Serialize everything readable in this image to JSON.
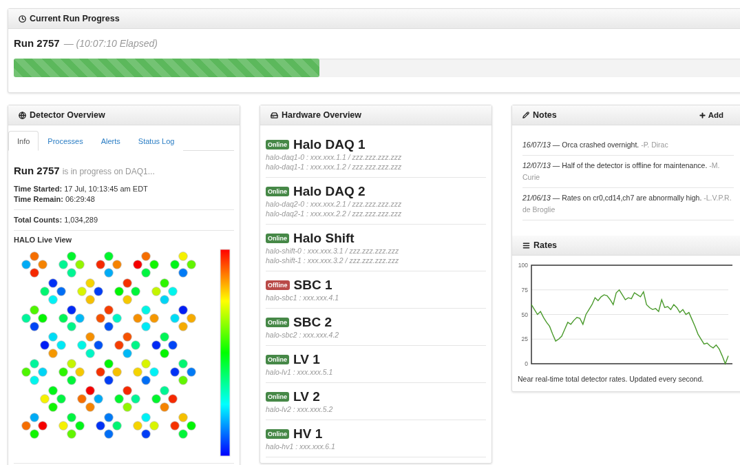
{
  "progress": {
    "title": "Current Run Progress",
    "run": "Run 2757",
    "elapsed": "— (10:07:10 Elapsed)",
    "level": 0.42
  },
  "detector": {
    "title": "Detector Overview",
    "tabs": [
      {
        "label": "Info",
        "selected": true
      },
      {
        "label": "Processes",
        "selected": false
      },
      {
        "label": "Alerts",
        "selected": false
      },
      {
        "label": "Status Log",
        "selected": false
      }
    ],
    "run": "Run 2757",
    "run_status": "is in progress on DAQ1...",
    "fields": [
      {
        "label": "Time Started:",
        "value": "17 Jul, 10:13:45 am EDT"
      },
      {
        "label": "Time Remain:",
        "value": "06:29:48"
      }
    ],
    "total": {
      "label": "Total Counts:",
      "value": "1,034,289"
    },
    "live_view_title": "HALO Live View"
  },
  "hardware": {
    "title": "Hardware Overview",
    "items": [
      {
        "status": "Online",
        "online": true,
        "name": "Halo DAQ 1",
        "hosts": [
          "halo-daq1-0 : xxx.xxx.1.1 / zzz.zzz.zzz.zzz",
          "halo-daq1-1 : xxx.xxx.1.2 / zzz.zzz.zzz.zzz"
        ]
      },
      {
        "status": "Online",
        "online": true,
        "name": "Halo DAQ 2",
        "hosts": [
          "halo-daq2-0 : xxx.xxx.2.1 / zzz.zzz.zzz.zzz",
          "halo-daq2-1 : xxx.xxx.2.2 / zzz.zzz.zzz.zzz"
        ]
      },
      {
        "status": "Online",
        "online": true,
        "name": "Halo Shift",
        "hosts": [
          "halo-shift-0 : xxx.xxx.3.1 / zzz.zzz.zzz.zzz",
          "halo-shift-1 : xxx.xxx.3.2 / zzz.zzz.zzz.zzz"
        ]
      },
      {
        "status": "Offline",
        "online": false,
        "name": "SBC 1",
        "hosts": [
          "halo-sbc1 : xxx.xxx.4.1"
        ]
      },
      {
        "status": "Online",
        "online": true,
        "name": "SBC 2",
        "hosts": [
          "halo-sbc2 : xxx.xxx.4.2"
        ]
      },
      {
        "status": "Online",
        "online": true,
        "name": "LV 1",
        "hosts": [
          "halo-lv1 : xxx.xxx.5.1"
        ]
      },
      {
        "status": "Online",
        "online": true,
        "name": "LV 2",
        "hosts": [
          "halo-lv2 : xxx.xxx.5.2"
        ]
      },
      {
        "status": "Online",
        "online": true,
        "name": "HV 1",
        "hosts": [
          "halo-hv1 : xxx.xxx.6.1"
        ]
      }
    ]
  },
  "notes": {
    "title": "Notes",
    "add": "Add",
    "items": [
      {
        "date": "16/07/13",
        "text": "— Orca crashed overnight.",
        "author": "-P. Dirac"
      },
      {
        "date": "12/07/13",
        "text": "— Half of the detector is offline for maintenance.",
        "author": "-M. Curie"
      },
      {
        "date": "21/06/13",
        "text": "— Rates on cr0,cd14,ch7 are abnormally high.",
        "author": "-L.V.P.R. de Broglie"
      }
    ]
  },
  "rates": {
    "title": "Rates",
    "caption": "Near real-time total detector rates. Updated every second.",
    "chart_data": {
      "type": "line",
      "grid": true,
      "ylim": [
        0,
        100
      ],
      "yticks": [
        0,
        25,
        50,
        75,
        100
      ],
      "series": [
        {
          "color": "#4a9a2c",
          "values": [
            60,
            55,
            50,
            53,
            47,
            42,
            38,
            30,
            23,
            25,
            28,
            35,
            42,
            40,
            44,
            47,
            46,
            40,
            50,
            55,
            60,
            67,
            64,
            68,
            70,
            69,
            65,
            60,
            72,
            75,
            70,
            65,
            67,
            66,
            72,
            70,
            68,
            73,
            60,
            57,
            55,
            56,
            53,
            65,
            57,
            58,
            55,
            60,
            57,
            52,
            55,
            50,
            52,
            45,
            38,
            30,
            25,
            20,
            21,
            18,
            16,
            19,
            15,
            8,
            0,
            8
          ]
        }
      ]
    }
  }
}
